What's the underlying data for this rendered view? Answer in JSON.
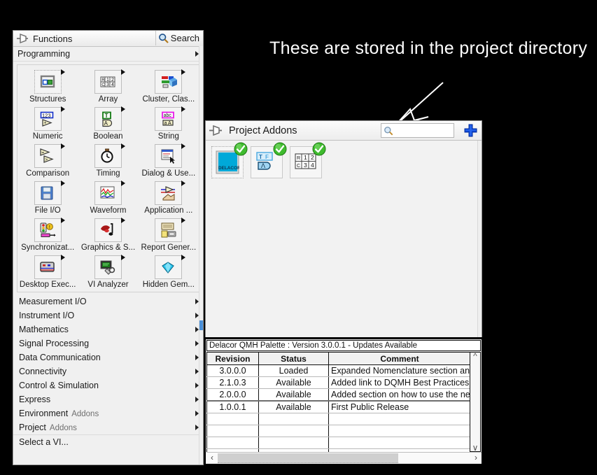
{
  "annotation": {
    "text": "These are stored in the project directory",
    "color": "#ffffff",
    "arrow": "arrow-down-left"
  },
  "functions_palette": {
    "pin_icon": "pin-icon",
    "title": "Functions",
    "search_icon": "search-icon",
    "search_label": "Search",
    "section_header": "Programming",
    "icons": [
      {
        "label": "Structures",
        "icon": "structures-icon"
      },
      {
        "label": "Array",
        "icon": "array-icon"
      },
      {
        "label": "Cluster, Clas...",
        "icon": "cluster-class-icon"
      },
      {
        "label": "Numeric",
        "icon": "numeric-icon"
      },
      {
        "label": "Boolean",
        "icon": "boolean-icon"
      },
      {
        "label": "String",
        "icon": "string-icon"
      },
      {
        "label": "Comparison",
        "icon": "comparison-icon"
      },
      {
        "label": "Timing",
        "icon": "timing-icon"
      },
      {
        "label": "Dialog & Use...",
        "icon": "dialog-user-interface-icon"
      },
      {
        "label": "File I/O",
        "icon": "file-io-icon"
      },
      {
        "label": "Waveform",
        "icon": "waveform-icon"
      },
      {
        "label": "Application ...",
        "icon": "application-control-icon"
      },
      {
        "label": "Synchronizat...",
        "icon": "synchronization-icon"
      },
      {
        "label": "Graphics & S...",
        "icon": "graphics-sound-icon"
      },
      {
        "label": "Report Gener...",
        "icon": "report-generation-icon"
      },
      {
        "label": "Desktop Exec...",
        "icon": "desktop-execution-trace-icon"
      },
      {
        "label": "VI Analyzer",
        "icon": "vi-analyzer-icon"
      },
      {
        "label": "Hidden Gem...",
        "icon": "hidden-gems-icon"
      }
    ],
    "menu_items": [
      {
        "label": "Measurement I/O",
        "sub": "",
        "arrow": true
      },
      {
        "label": "Instrument I/O",
        "sub": "",
        "arrow": true
      },
      {
        "label": "Mathematics",
        "sub": "",
        "arrow": true
      },
      {
        "label": "Signal Processing",
        "sub": "",
        "arrow": true
      },
      {
        "label": "Data Communication",
        "sub": "",
        "arrow": true
      },
      {
        "label": "Connectivity",
        "sub": "",
        "arrow": true
      },
      {
        "label": "Control & Simulation",
        "sub": "",
        "arrow": true
      },
      {
        "label": "Express",
        "sub": "",
        "arrow": true
      },
      {
        "label": "Environment",
        "sub": "Addons",
        "arrow": true
      },
      {
        "label": "Project",
        "sub": "Addons",
        "arrow": true
      },
      {
        "label": "Select a VI...",
        "sub": "",
        "arrow": false
      }
    ]
  },
  "project_addons": {
    "pin_icon": "pin-icon",
    "title": "Project Addons",
    "search_icon": "search-icon",
    "search_value": "",
    "search_placeholder": "",
    "add_icon": "blue-plus-icon",
    "items": [
      {
        "name": "DELACOR",
        "icon": "delacor-palette-icon",
        "badge": "green-check-icon"
      },
      {
        "name": "TF",
        "icon": "boolean-palette-icon",
        "badge": "green-check-icon"
      },
      {
        "name": "RC1234",
        "icon": "array-palette-icon",
        "badge": "green-check-icon"
      }
    ]
  },
  "revision_panel": {
    "caption": "Delacor QMH Palette : Version 3.0.0.1 - Updates Available",
    "columns": [
      "Revision",
      "Status",
      "Comment"
    ],
    "rows": [
      {
        "revision": "3.0.0.0",
        "status": "Loaded",
        "comment": "Expanded Nomenclature section and"
      },
      {
        "revision": "2.1.0.3",
        "status": "Available",
        "comment": " Added link to DQMH Best Practices"
      },
      {
        "revision": "2.0.0.0",
        "status": "Available",
        "comment": "Added section on how to use the new"
      },
      {
        "revision": "1.0.0.1",
        "status": "Available",
        "comment": "First Public Release"
      },
      {
        "revision": "",
        "status": "",
        "comment": ""
      },
      {
        "revision": "",
        "status": "",
        "comment": ""
      },
      {
        "revision": "",
        "status": "",
        "comment": ""
      },
      {
        "revision": "",
        "status": "",
        "comment": ""
      }
    ],
    "scroll_up_icon": "chevron-up-icon",
    "scroll_down_icon": "chevron-down-icon",
    "scroll_left_icon": "chevron-left-icon",
    "scroll_right_icon": "chevron-right-icon"
  },
  "colors": {
    "background": "#000000",
    "panel": "#f0f0f0",
    "accent": "#0040d0",
    "check": "#35b22b"
  }
}
